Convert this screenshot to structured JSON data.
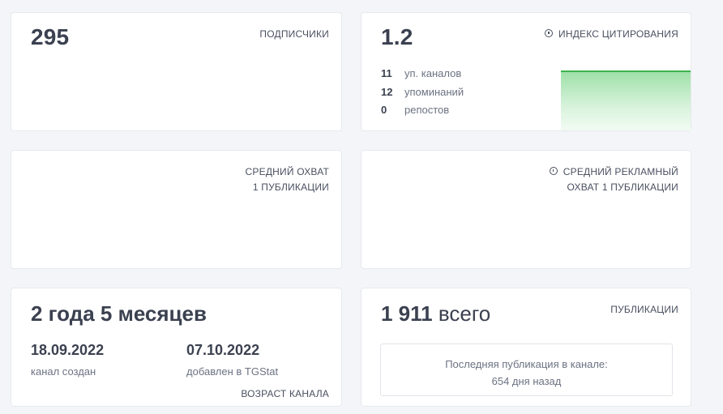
{
  "subscribers": {
    "value": "295",
    "label": "ПОДПИСЧИКИ"
  },
  "citation": {
    "value": "1.2",
    "label": "ИНДЕКС ЦИТИРОВАНИЯ",
    "icon": "info-icon",
    "stats": [
      {
        "num": "11",
        "text": "уп. каналов"
      },
      {
        "num": "12",
        "text": "упоминаний"
      },
      {
        "num": "0",
        "text": "репостов"
      }
    ],
    "sparkline_color": "#3db34d"
  },
  "avg_reach": {
    "label_line1": "СРЕДНИЙ ОХВАТ",
    "label_line2": "1 ПУБЛИКАЦИИ"
  },
  "avg_ad_reach": {
    "icon": "info-icon",
    "label_line1": "СРЕДНИЙ РЕКЛАМНЫЙ",
    "label_line2": "ОХВАТ 1 ПУБЛИКАЦИИ"
  },
  "channel_age": {
    "title": "2 года 5 месяцев",
    "created_date": "18.09.2022",
    "created_caption": "канал создан",
    "added_date": "07.10.2022",
    "added_caption": "добавлен в TGStat",
    "label": "ВОЗРАСТ КАНАЛА"
  },
  "posts": {
    "count": "1 911",
    "count_suffix": "всего",
    "label": "ПУБЛИКАЦИИ",
    "last_line1": "Последняя публикация в канале:",
    "last_line2": "654 дня назад"
  }
}
